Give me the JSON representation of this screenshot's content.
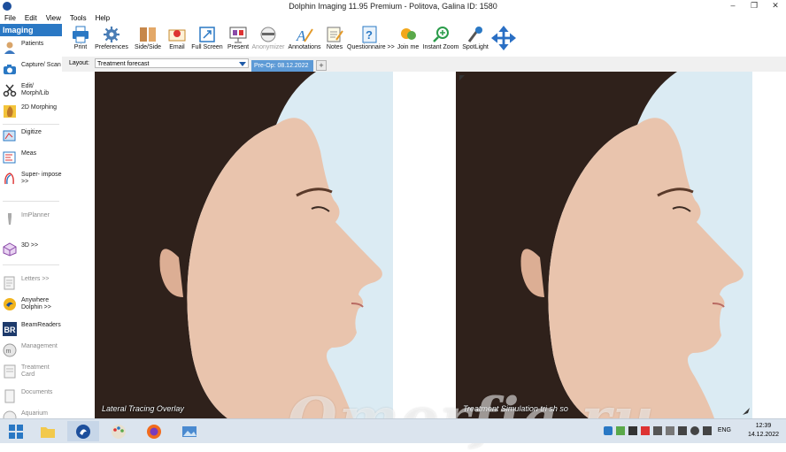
{
  "window": {
    "title": "Dolphin Imaging 11.95 Premium - Politova, Galina  ID: 1580"
  },
  "menu": [
    "File",
    "Edit",
    "View",
    "Tools",
    "Help"
  ],
  "sidebar": {
    "header": "Imaging",
    "items": [
      {
        "label": "Patients"
      },
      {
        "label": "Capture/ Scan"
      },
      {
        "label": "Edit/ Morph/Lib"
      },
      {
        "label": "2D Morphing"
      },
      {
        "label": "Digitize"
      },
      {
        "label": "Meas"
      },
      {
        "label": "Super- impose >>"
      },
      {
        "label": "ImPlanner"
      },
      {
        "label": "3D >>"
      },
      {
        "label": "Letters >>"
      },
      {
        "label": "Anywhere Dolphin >>"
      },
      {
        "label": "BeamReaders"
      },
      {
        "label": "Management"
      },
      {
        "label": "Treatment Card"
      },
      {
        "label": "Documents"
      },
      {
        "label": "Aquarium"
      }
    ]
  },
  "toolbar": {
    "buttons": [
      {
        "label": "Print"
      },
      {
        "label": "Preferences"
      },
      {
        "label": "Side/Side"
      },
      {
        "label": "Email"
      },
      {
        "label": "Full Screen"
      },
      {
        "label": "Present"
      },
      {
        "label": "Anonymizer"
      },
      {
        "label": "Annotations"
      },
      {
        "label": "Notes"
      },
      {
        "label": "Questionnaire >>"
      },
      {
        "label": "Join me"
      },
      {
        "label": "Instant Zoom"
      },
      {
        "label": "SpotLight"
      }
    ]
  },
  "layout": {
    "label": "Layout:",
    "selected": "Treatment forecast",
    "tab": "Pre-Op: 08.12.2022",
    "add_tab": "+"
  },
  "photos": [
    {
      "caption": "Lateral Tracing Overlay"
    },
    {
      "caption": "Treatment Simulation tri sh so"
    }
  ],
  "watermark": "Omorfia.ru",
  "taskbar": {
    "lang": "ENG",
    "time": "12:39",
    "date": "14.12.2022"
  },
  "colors": {
    "accent": "#2a78c4",
    "tab": "#5d9ad6",
    "photo_bg": "#d9eaf2",
    "hair": "#3a2a22",
    "skin": "#e8c3ad"
  }
}
